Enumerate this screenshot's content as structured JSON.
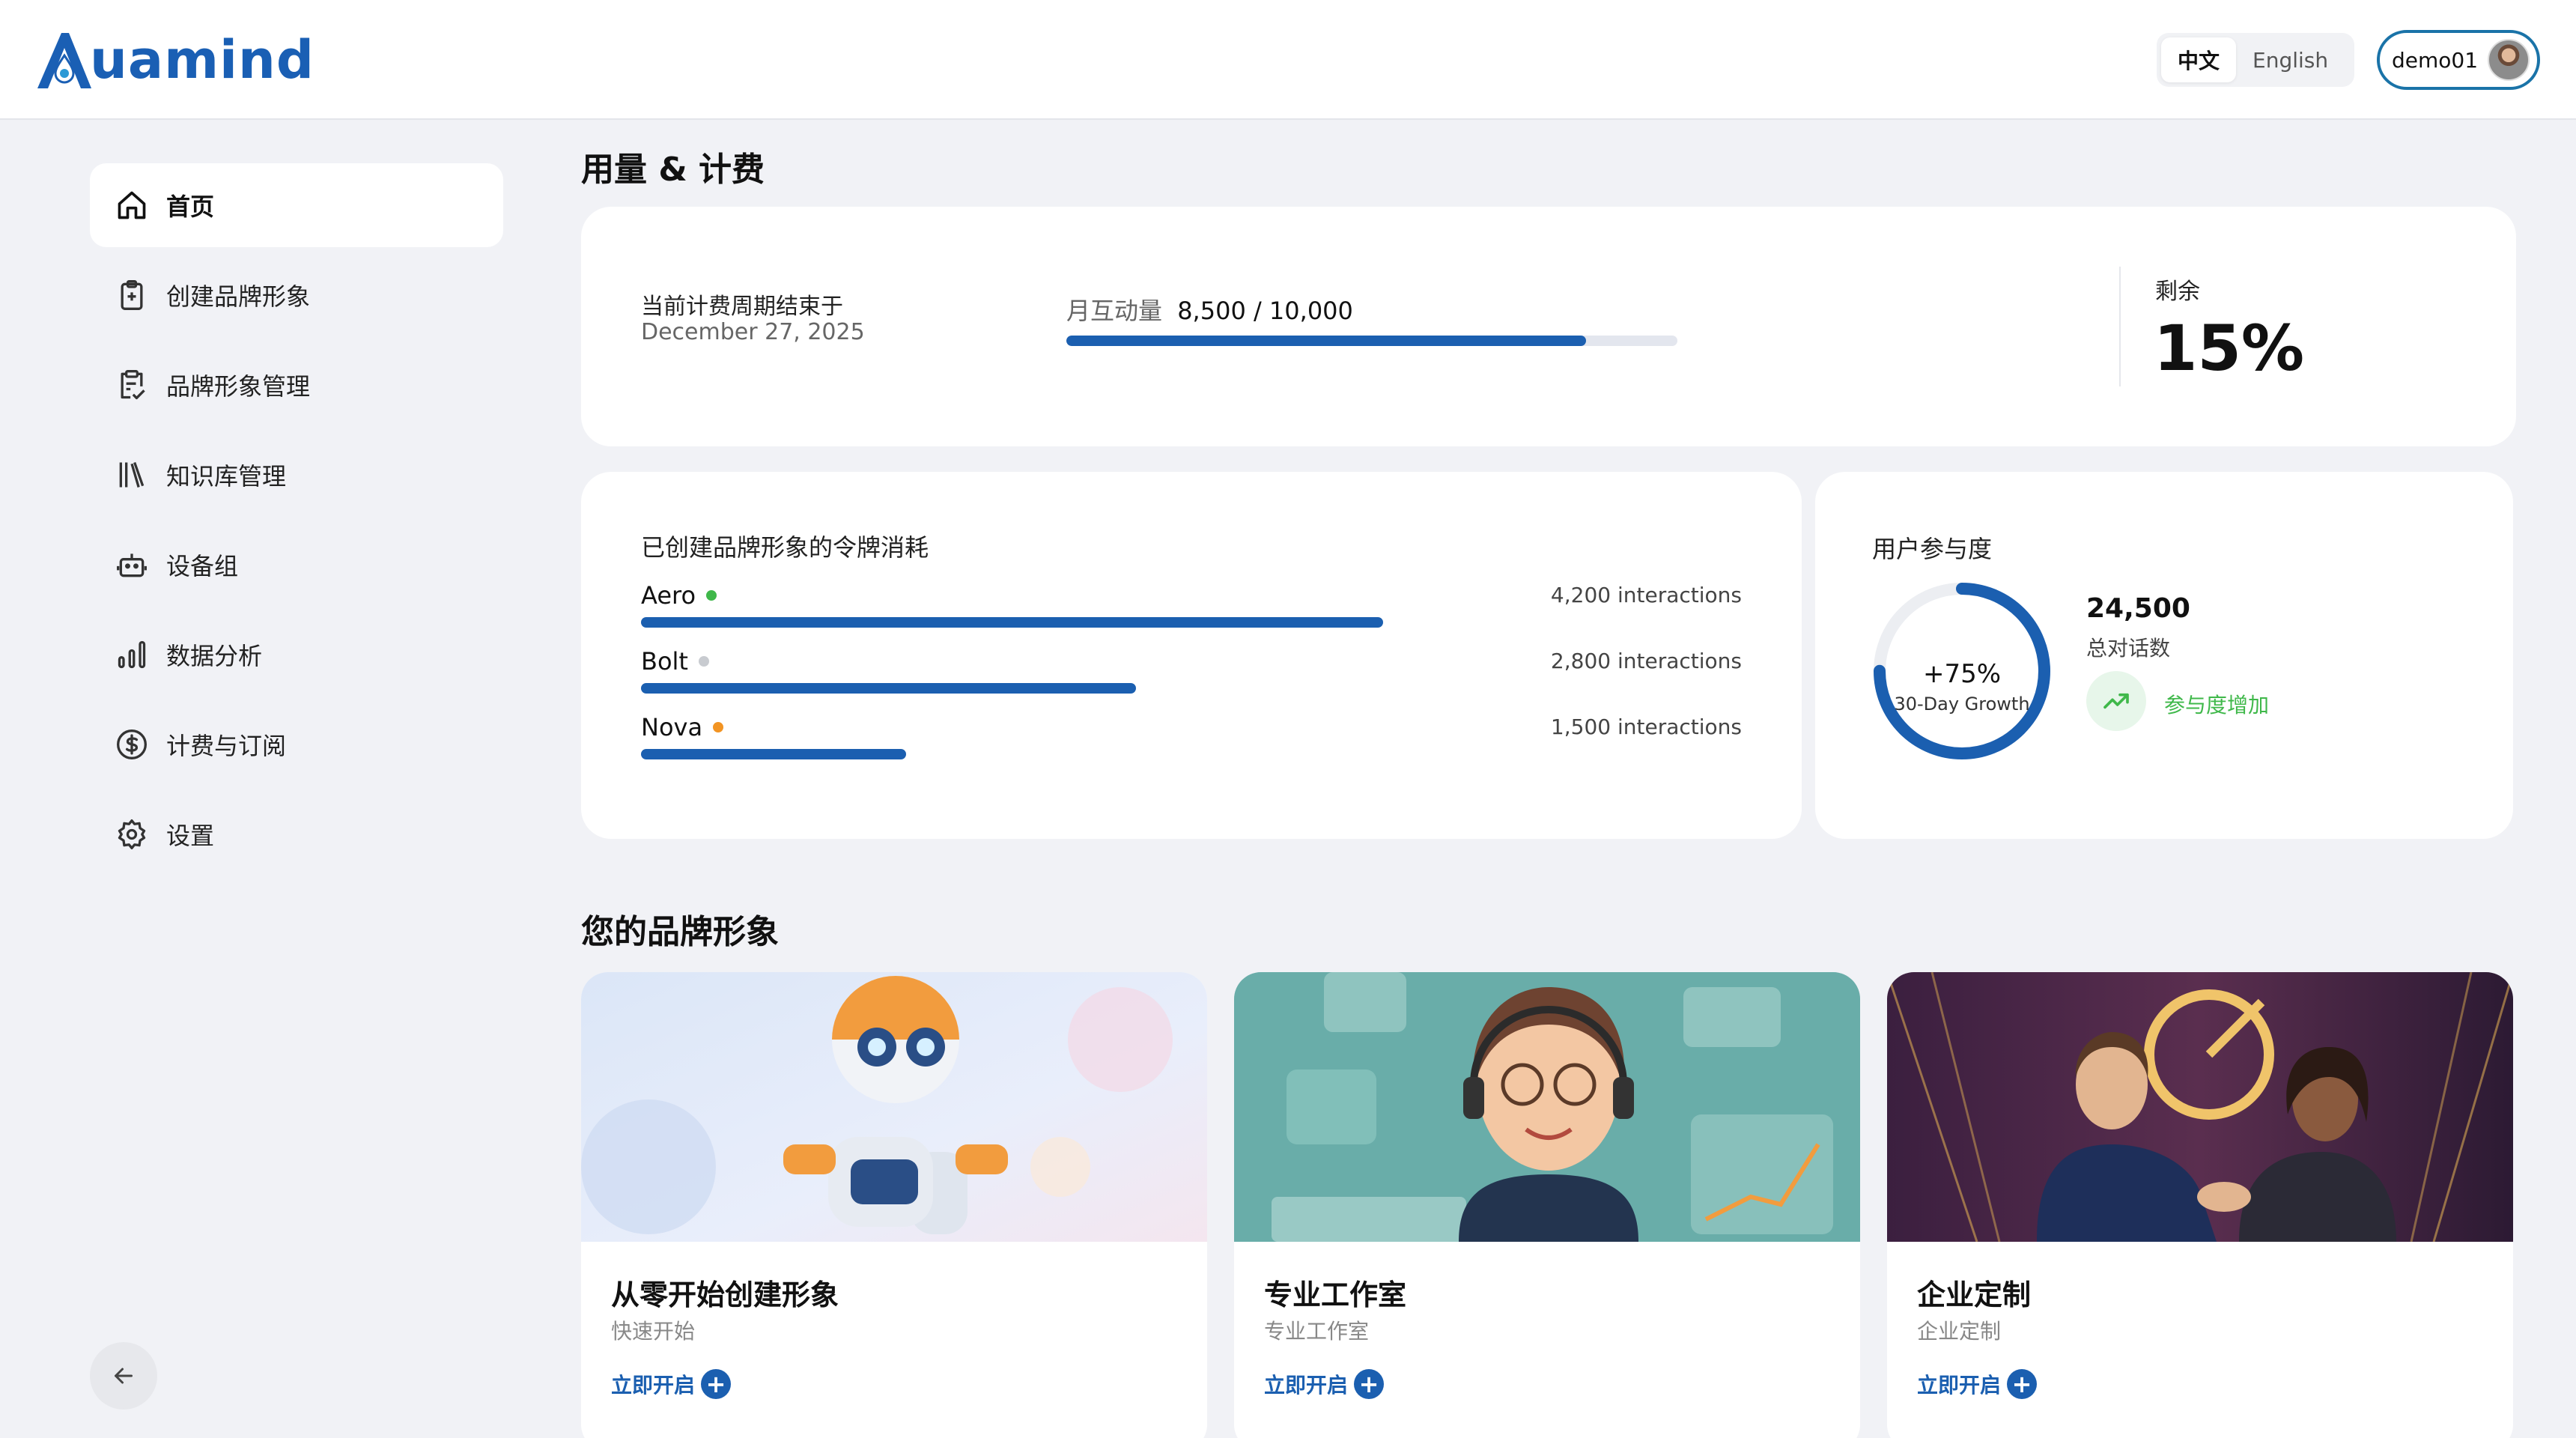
{
  "brand": {
    "logo_text": "uamind"
  },
  "header": {
    "lang_zh": "中文",
    "lang_en": "English",
    "username": "demo01"
  },
  "sidebar": {
    "items": [
      {
        "label": "首页",
        "icon": "home-icon"
      },
      {
        "label": "创建品牌形象",
        "icon": "clipboard-plus-icon"
      },
      {
        "label": "品牌形象管理",
        "icon": "clipboard-check-icon"
      },
      {
        "label": "知识库管理",
        "icon": "library-icon"
      },
      {
        "label": "设备组",
        "icon": "robot-icon"
      },
      {
        "label": "数据分析",
        "icon": "bar-chart-icon"
      },
      {
        "label": "计费与订阅",
        "icon": "dollar-circle-icon"
      },
      {
        "label": "设置",
        "icon": "gear-icon"
      }
    ],
    "collapse_icon": "arrow-left-icon"
  },
  "usage": {
    "section_title": "用量 & 计费",
    "cycle_label": "当前计费周期结束于",
    "cycle_date": "December 27, 2025",
    "monthly_label": "月互动量",
    "monthly_value": "8,500 / 10,000",
    "monthly_fraction": 0.85,
    "remaining_label": "剩余",
    "remaining_value": "15%"
  },
  "tokens": {
    "title": "已创建品牌形象的令牌消耗",
    "rows": [
      {
        "name": "Aero",
        "count": "4,200 interactions",
        "value": 4200,
        "dot_color": "#3fb84a"
      },
      {
        "name": "Bolt",
        "count": "2,800 interactions",
        "value": 2800,
        "dot_color": "#c8cbd0"
      },
      {
        "name": "Nova",
        "count": "1,500 interactions",
        "value": 1500,
        "dot_color": "#f29423"
      }
    ],
    "max_value": 5000
  },
  "engagement": {
    "title": "用户参与度",
    "growth": "+75%",
    "growth_label": "30-Day Growth",
    "growth_fraction": 0.75,
    "total_value": "24,500",
    "total_label": "总对话数",
    "trend_text": "参与度增加"
  },
  "brands": {
    "section_title": "您的品牌形象",
    "cards": [
      {
        "name": "从零开始创建形象",
        "sub": "快速开始",
        "cta": "立即开启"
      },
      {
        "name": "专业工作室",
        "sub": "专业工作室",
        "cta": "立即开启"
      },
      {
        "name": "企业定制",
        "sub": "企业定制",
        "cta": "立即开启"
      }
    ]
  },
  "colors": {
    "accent": "#1b5fb0",
    "positive": "#3fb84a",
    "background": "#f1f2f6"
  }
}
